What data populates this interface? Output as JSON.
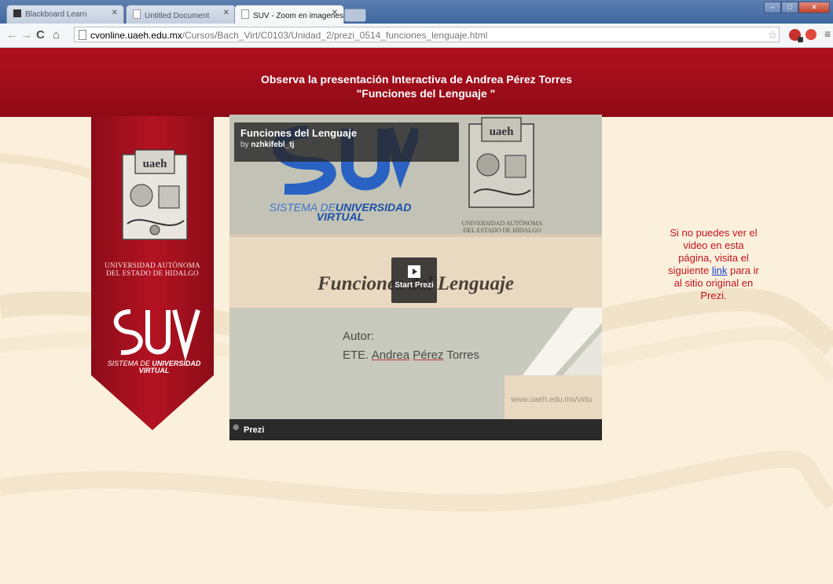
{
  "browser": {
    "tabs": [
      {
        "label": "Blackboard Learn",
        "active": false
      },
      {
        "label": "Untitled Document",
        "active": false
      },
      {
        "label": "SUV - Zoom en imagenes",
        "active": true
      }
    ],
    "url_domain": "cvonline.uaeh.edu.mx",
    "url_path": "/Cursos/Bach_Virt/C0103/Unidad_2/prezi_0514_funciones_lenguaje.html",
    "icons": [
      "back-icon",
      "forward-icon",
      "reload-icon",
      "home-icon",
      "star-icon",
      "menu-icon"
    ]
  },
  "header": {
    "line1": "Observa la presentación Interactiva de Andrea Pérez Torres",
    "line2": "\"Funciones del Lenguaje \""
  },
  "ribbon": {
    "uni_line1": "UNIVERSIDAD AUTÓNOMA",
    "uni_line2": "DEL ESTADO DE HIDALGO",
    "suv_line1": "SISTEMA DE",
    "suv_line1b": "UNIVERSIDAD",
    "suv_line2": "VIRTUAL"
  },
  "prezi": {
    "title": "Funciones del Lenguaje",
    "by_prefix": "by",
    "author_handle": "nzhkifebl_tj",
    "suv_caption_a": "SISTEMA DE",
    "suv_caption_b": "UNIVERSIDAD",
    "suv_caption_c": "VIRTUAL",
    "uni_line1": "UNIVERSIDAD AUTÓNOMA",
    "uni_line2": "DEL ESTADO DE HIDALGO",
    "slide_heading": "Funciones del Lenguaje",
    "start_label": "Start Prezi",
    "autor_label": "Autor:",
    "autor_prefix": "ETE.",
    "autor_name_u1": "Andrea",
    "autor_name_mid": "Pérez",
    "autor_name_end": "Torres",
    "watermark_url": "www.uaeh.edu.mx/virtu",
    "footer_label": "Prezi"
  },
  "side_note": {
    "text_before": "Si no puedes ver el video en esta página, visita el siguiente",
    "link_text": "link",
    "text_after": "para ir al sitio original en Prezi."
  },
  "colors": {
    "brand_red": "#b0101e",
    "page_bg": "#fbf0dc",
    "note_red": "#c4131e",
    "link_blue": "#1a3cc7"
  }
}
